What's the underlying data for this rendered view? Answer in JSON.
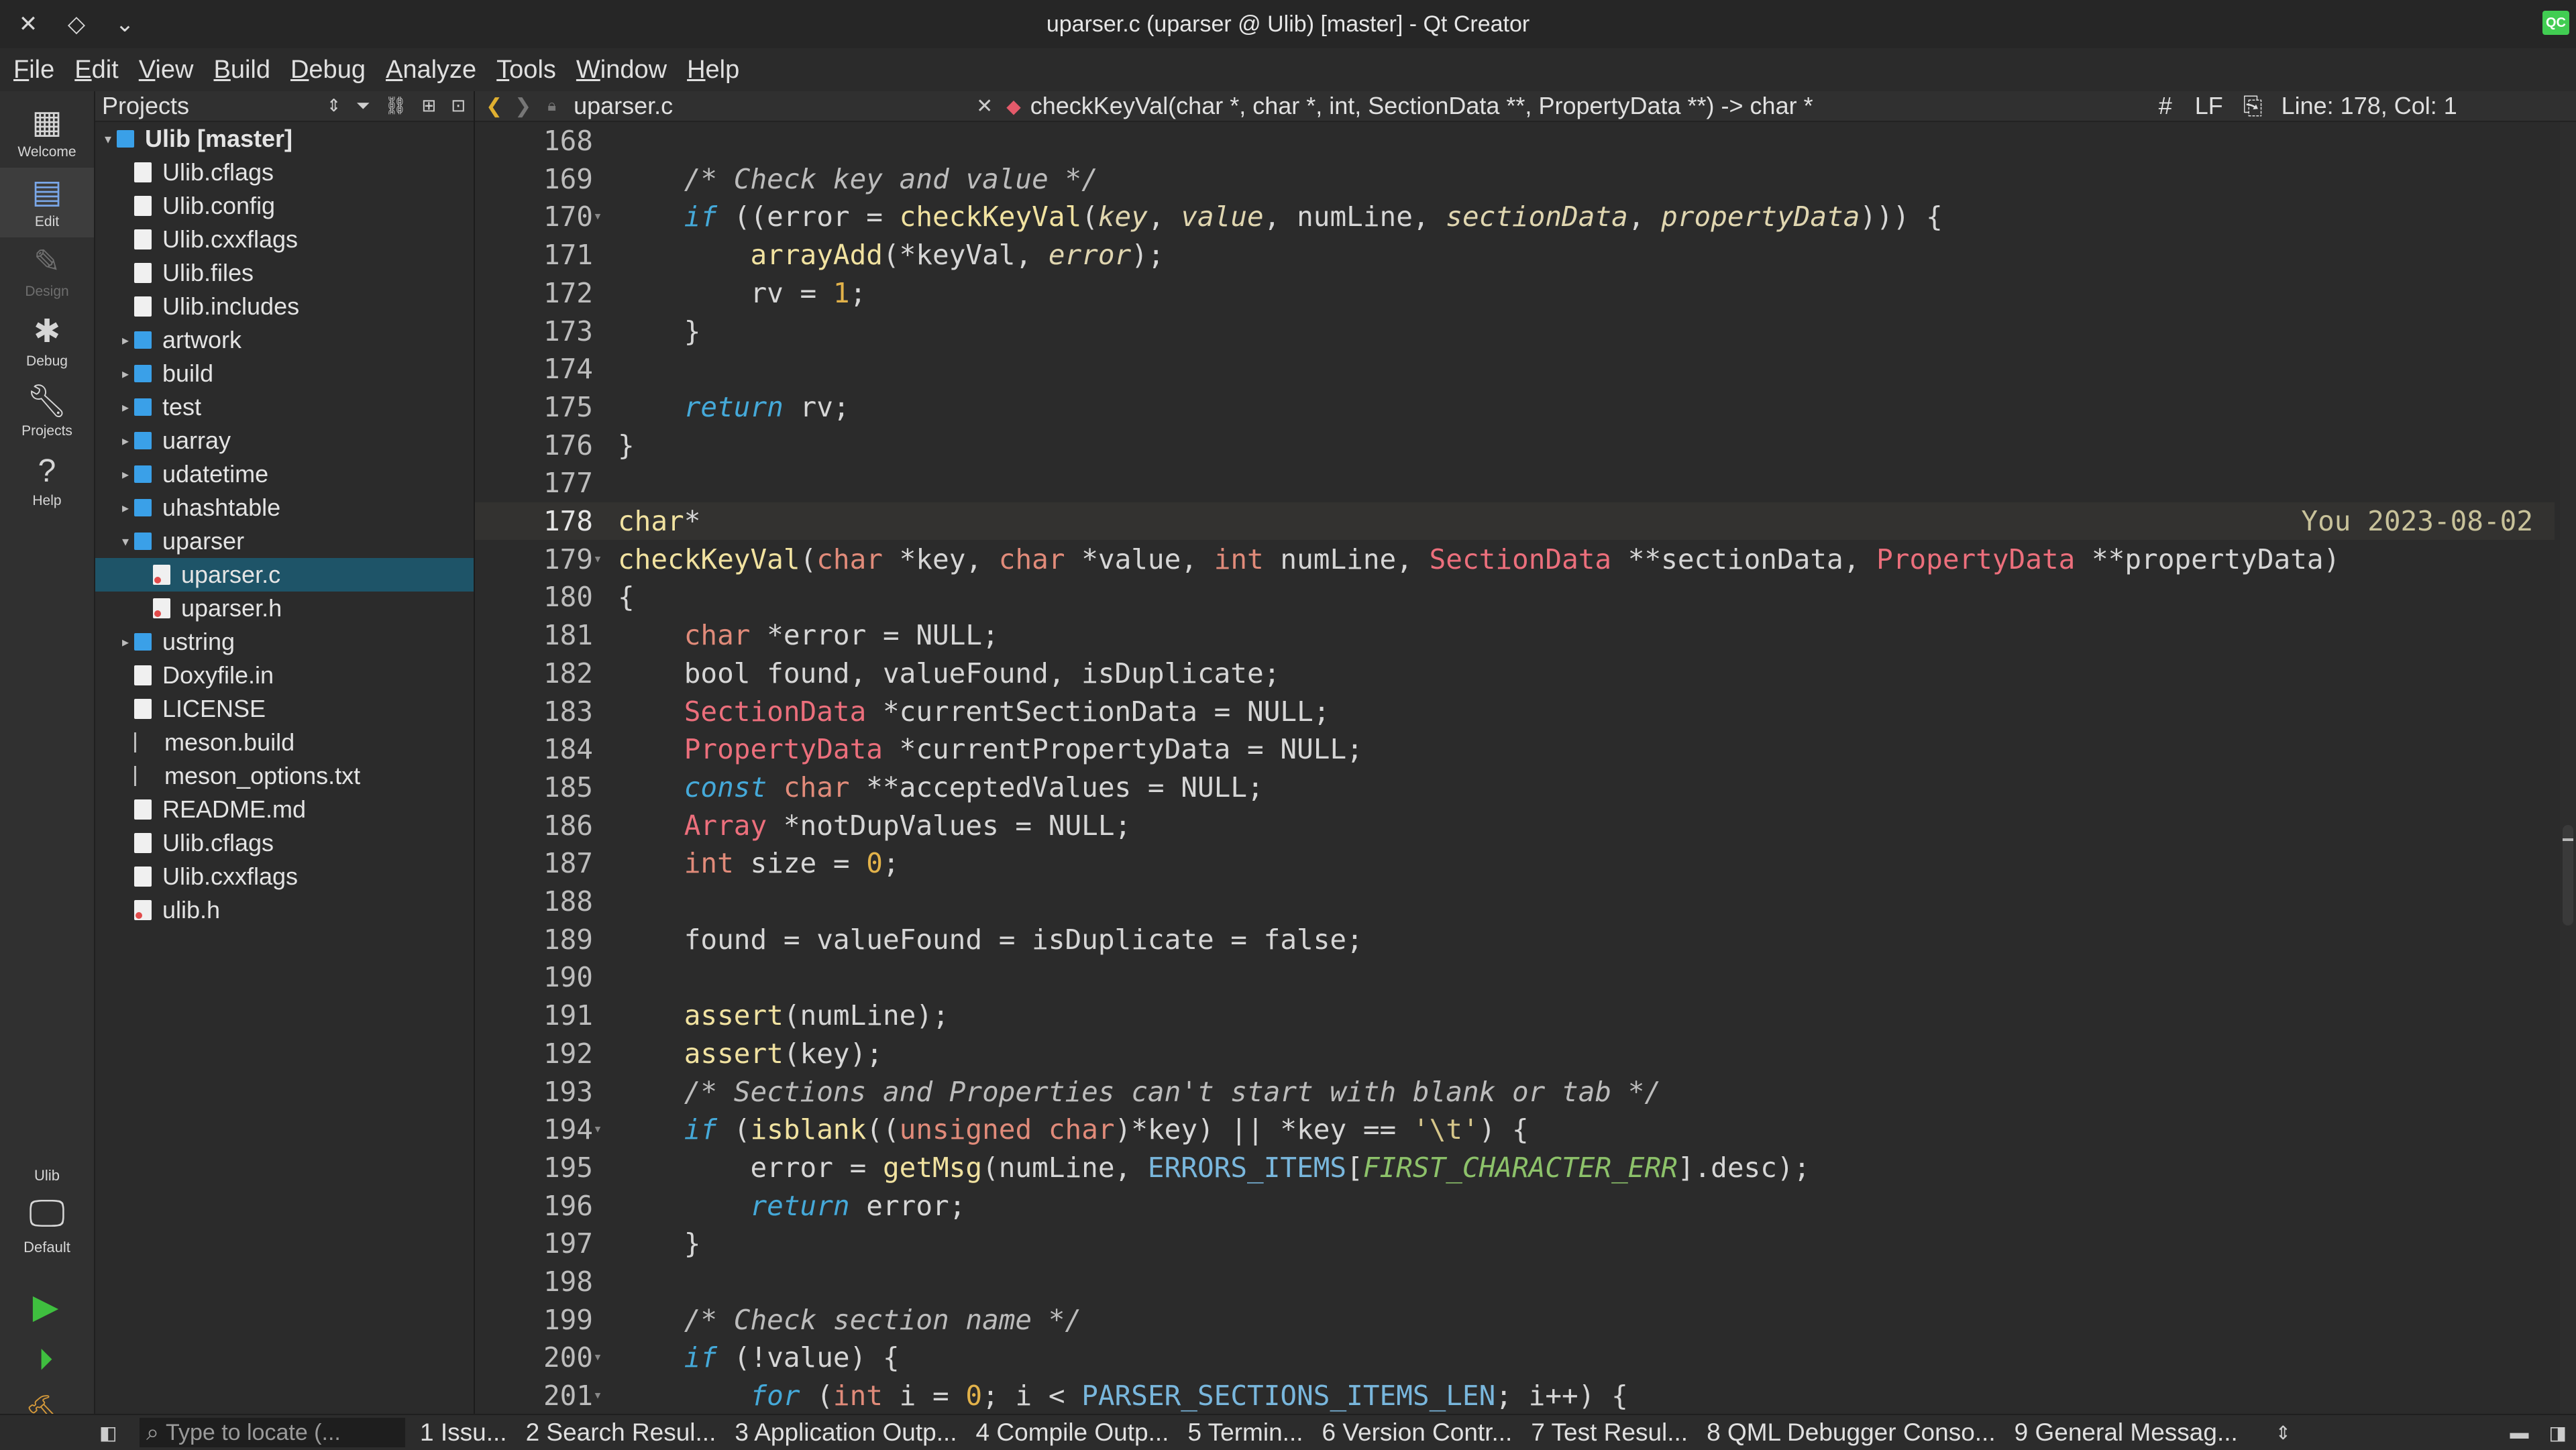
{
  "window": {
    "title": "uparser.c (uparser @ Ulib) [master] - Qt Creator",
    "logo": "QC"
  },
  "menu": [
    {
      "label": "File",
      "mnemonic": "F"
    },
    {
      "label": "Edit",
      "mnemonic": "E"
    },
    {
      "label": "View",
      "mnemonic": "V"
    },
    {
      "label": "Build",
      "mnemonic": "B"
    },
    {
      "label": "Debug",
      "mnemonic": "D"
    },
    {
      "label": "Analyze",
      "mnemonic": "A"
    },
    {
      "label": "Tools",
      "mnemonic": "T"
    },
    {
      "label": "Window",
      "mnemonic": "W"
    },
    {
      "label": "Help",
      "mnemonic": "H"
    }
  ],
  "modes": [
    {
      "label": "Welcome",
      "icon": "grid-icon",
      "state": "normal"
    },
    {
      "label": "Edit",
      "icon": "edit-icon",
      "state": "active"
    },
    {
      "label": "Design",
      "icon": "pencil-icon",
      "state": "disabled"
    },
    {
      "label": "Debug",
      "icon": "bug-icon",
      "state": "normal"
    },
    {
      "label": "Projects",
      "icon": "wrench-icon",
      "state": "normal"
    },
    {
      "label": "Help",
      "icon": "help-icon",
      "state": "normal"
    }
  ],
  "kit": {
    "project": "Ulib",
    "label": "Default",
    "icon": "monitor-icon"
  },
  "projects": {
    "title": "Projects",
    "tree": [
      {
        "label": "Ulib [master]",
        "type": "root",
        "expanded": true,
        "indent": 0
      },
      {
        "label": "Ulib.cflags",
        "type": "file",
        "indent": 1
      },
      {
        "label": "Ulib.config",
        "type": "file",
        "indent": 1
      },
      {
        "label": "Ulib.cxxflags",
        "type": "file",
        "indent": 1
      },
      {
        "label": "Ulib.files",
        "type": "file",
        "indent": 1
      },
      {
        "label": "Ulib.includes",
        "type": "file",
        "indent": 1
      },
      {
        "label": "artwork",
        "type": "folder",
        "indent": 1
      },
      {
        "label": "build",
        "type": "folder",
        "indent": 1
      },
      {
        "label": "test",
        "type": "folder",
        "indent": 1
      },
      {
        "label": "uarray",
        "type": "folder",
        "indent": 1
      },
      {
        "label": "udatetime",
        "type": "folder",
        "indent": 1
      },
      {
        "label": "uhashtable",
        "type": "folder",
        "indent": 1
      },
      {
        "label": "uparser",
        "type": "folder",
        "expanded": true,
        "indent": 1
      },
      {
        "label": "uparser.c",
        "type": "cfile",
        "indent": 2,
        "selected": true
      },
      {
        "label": "uparser.h",
        "type": "cfile",
        "indent": 2
      },
      {
        "label": "ustring",
        "type": "folder",
        "indent": 1
      },
      {
        "label": "Doxyfile.in",
        "type": "file",
        "indent": 1
      },
      {
        "label": "LICENSE",
        "type": "file",
        "indent": 1
      },
      {
        "label": "meson.build",
        "type": "txt",
        "indent": 1
      },
      {
        "label": "meson_options.txt",
        "type": "txt",
        "indent": 1
      },
      {
        "label": "README.md",
        "type": "file",
        "indent": 1
      },
      {
        "label": "Ulib.cflags",
        "type": "file",
        "indent": 1
      },
      {
        "label": "Ulib.cxxflags",
        "type": "file",
        "indent": 1
      },
      {
        "label": "ulib.h",
        "type": "cfile",
        "indent": 1
      }
    ]
  },
  "editor_toolbar": {
    "file": "uparser.c",
    "symbol": "checkKeyVal(char *, char *, int, SectionData **, PropertyData **) -> char *",
    "hash": "#",
    "line_ending": "LF",
    "position": "Line: 178, Col: 1"
  },
  "blame": "You 2023-08-02",
  "current_line": 178,
  "code": [
    {
      "n": "168",
      "t": [
        [
          "",
          ""
        ]
      ]
    },
    {
      "n": "169",
      "t": [
        [
          "    ",
          "plain"
        ],
        [
          "/* Check key and value */",
          "cm"
        ]
      ]
    },
    {
      "n": "170",
      "fold": true,
      "t": [
        [
          "    ",
          "plain"
        ],
        [
          "if",
          "kw"
        ],
        [
          " ((error = ",
          "plain"
        ],
        [
          "checkKeyVal",
          "fn"
        ],
        [
          "(",
          "plain"
        ],
        [
          "key",
          "it"
        ],
        [
          ", ",
          "plain"
        ],
        [
          "value",
          "it"
        ],
        [
          ", numLine, ",
          "plain"
        ],
        [
          "sectionData",
          "it"
        ],
        [
          ", ",
          "plain"
        ],
        [
          "propertyData",
          "it"
        ],
        [
          "))) {",
          "plain"
        ]
      ]
    },
    {
      "n": "171",
      "t": [
        [
          "        ",
          "plain"
        ],
        [
          "arrayAdd",
          "fn"
        ],
        [
          "(*keyVal, ",
          "plain"
        ],
        [
          "error",
          "it"
        ],
        [
          ");",
          "plain"
        ]
      ]
    },
    {
      "n": "172",
      "t": [
        [
          "        rv = ",
          "plain"
        ],
        [
          "1",
          "num"
        ],
        [
          ";",
          "plain"
        ]
      ]
    },
    {
      "n": "173",
      "t": [
        [
          "    }",
          "plain"
        ]
      ]
    },
    {
      "n": "174",
      "t": [
        [
          "",
          ""
        ]
      ]
    },
    {
      "n": "175",
      "t": [
        [
          "    ",
          "plain"
        ],
        [
          "return",
          "kw"
        ],
        [
          " rv;",
          "plain"
        ]
      ]
    },
    {
      "n": "176",
      "t": [
        [
          "}",
          "plain"
        ]
      ]
    },
    {
      "n": "177",
      "t": [
        [
          "",
          ""
        ]
      ]
    },
    {
      "n": "178",
      "t": [
        [
          "char",
          "fn"
        ],
        [
          "*",
          "plain"
        ]
      ]
    },
    {
      "n": "179",
      "fold": true,
      "t": [
        [
          "checkKeyVal",
          "fn"
        ],
        [
          "(",
          "plain"
        ],
        [
          "char",
          "ty"
        ],
        [
          " *key, ",
          "plain"
        ],
        [
          "char",
          "ty"
        ],
        [
          " *value, ",
          "plain"
        ],
        [
          "int",
          "ty"
        ],
        [
          " numLine, ",
          "plain"
        ],
        [
          "SectionData",
          "tyr"
        ],
        [
          " **sectionData, ",
          "plain"
        ],
        [
          "PropertyData",
          "tyr"
        ],
        [
          " **propertyData)",
          "plain"
        ]
      ]
    },
    {
      "n": "180",
      "t": [
        [
          "{",
          "plain"
        ]
      ]
    },
    {
      "n": "181",
      "t": [
        [
          "    ",
          "plain"
        ],
        [
          "char",
          "ty"
        ],
        [
          " *error = NULL;",
          "plain"
        ]
      ]
    },
    {
      "n": "182",
      "t": [
        [
          "    bool found, valueFound, isDuplicate;",
          "plain"
        ]
      ]
    },
    {
      "n": "183",
      "t": [
        [
          "    ",
          "plain"
        ],
        [
          "SectionData",
          "tyr"
        ],
        [
          " *currentSectionData = NULL;",
          "plain"
        ]
      ]
    },
    {
      "n": "184",
      "t": [
        [
          "    ",
          "plain"
        ],
        [
          "PropertyData",
          "tyr"
        ],
        [
          " *currentPropertyData = NULL;",
          "plain"
        ]
      ]
    },
    {
      "n": "185",
      "t": [
        [
          "    ",
          "plain"
        ],
        [
          "const",
          "kw"
        ],
        [
          " ",
          "plain"
        ],
        [
          "char",
          "ty"
        ],
        [
          " **acceptedValues = NULL;",
          "plain"
        ]
      ]
    },
    {
      "n": "186",
      "t": [
        [
          "    ",
          "plain"
        ],
        [
          "Array",
          "tyr"
        ],
        [
          " *notDupValues = NULL;",
          "plain"
        ]
      ]
    },
    {
      "n": "187",
      "t": [
        [
          "    ",
          "plain"
        ],
        [
          "int",
          "ty"
        ],
        [
          " size = ",
          "plain"
        ],
        [
          "0",
          "num"
        ],
        [
          ";",
          "plain"
        ]
      ]
    },
    {
      "n": "188",
      "t": [
        [
          "",
          ""
        ]
      ]
    },
    {
      "n": "189",
      "t": [
        [
          "    found = valueFound = isDuplicate = false;",
          "plain"
        ]
      ]
    },
    {
      "n": "190",
      "t": [
        [
          "",
          ""
        ]
      ]
    },
    {
      "n": "191",
      "t": [
        [
          "    ",
          "plain"
        ],
        [
          "assert",
          "fn"
        ],
        [
          "(numLine);",
          "plain"
        ]
      ]
    },
    {
      "n": "192",
      "t": [
        [
          "    ",
          "plain"
        ],
        [
          "assert",
          "fn"
        ],
        [
          "(key);",
          "plain"
        ]
      ]
    },
    {
      "n": "193",
      "t": [
        [
          "    ",
          "plain"
        ],
        [
          "/* Sections and Properties can't start with blank or tab */",
          "cm"
        ]
      ]
    },
    {
      "n": "194",
      "fold": true,
      "t": [
        [
          "    ",
          "plain"
        ],
        [
          "if",
          "kw"
        ],
        [
          " (",
          "plain"
        ],
        [
          "isblank",
          "fn"
        ],
        [
          "((",
          "plain"
        ],
        [
          "unsigned",
          "ty"
        ],
        [
          " ",
          "plain"
        ],
        [
          "char",
          "ty"
        ],
        [
          ")*key) || *key == ",
          "plain"
        ],
        [
          "'\\t'",
          "str"
        ],
        [
          ") {",
          "plain"
        ]
      ]
    },
    {
      "n": "195",
      "t": [
        [
          "        error = ",
          "plain"
        ],
        [
          "getMsg",
          "fn"
        ],
        [
          "(numLine, ",
          "plain"
        ],
        [
          "ERRORS_ITEMS",
          "cst"
        ],
        [
          "[",
          "plain"
        ],
        [
          "FIRST_CHARACTER_ERR",
          "enum"
        ],
        [
          "].desc);",
          "plain"
        ]
      ]
    },
    {
      "n": "196",
      "t": [
        [
          "        ",
          "plain"
        ],
        [
          "return",
          "kw"
        ],
        [
          " error;",
          "plain"
        ]
      ]
    },
    {
      "n": "197",
      "t": [
        [
          "    }",
          "plain"
        ]
      ]
    },
    {
      "n": "198",
      "t": [
        [
          "",
          ""
        ]
      ]
    },
    {
      "n": "199",
      "t": [
        [
          "    ",
          "plain"
        ],
        [
          "/* Check section name */",
          "cm"
        ]
      ]
    },
    {
      "n": "200",
      "fold": true,
      "t": [
        [
          "    ",
          "plain"
        ],
        [
          "if",
          "kw"
        ],
        [
          " (!value) {",
          "plain"
        ]
      ]
    },
    {
      "n": "201",
      "fold": true,
      "t": [
        [
          "        ",
          "plain"
        ],
        [
          "for",
          "kw"
        ],
        [
          " (",
          "plain"
        ],
        [
          "int",
          "ty"
        ],
        [
          " i = ",
          "plain"
        ],
        [
          "0",
          "num"
        ],
        [
          "; i < ",
          "plain"
        ],
        [
          "PARSER_SECTIONS_ITEMS_LEN",
          "cst"
        ],
        [
          "; i++) {",
          "plain"
        ]
      ]
    }
  ],
  "statusbar": {
    "locator_placeholder": "Type to locate (...",
    "tabs": [
      "1 Issu...",
      "2 Search Resul...",
      "3 Application Outp...",
      "4 Compile Outp...",
      "5 Termin...",
      "6 Version Contr...",
      "7 Test Resul...",
      "8 QML Debugger Conso...",
      "9 General Messag..."
    ]
  }
}
